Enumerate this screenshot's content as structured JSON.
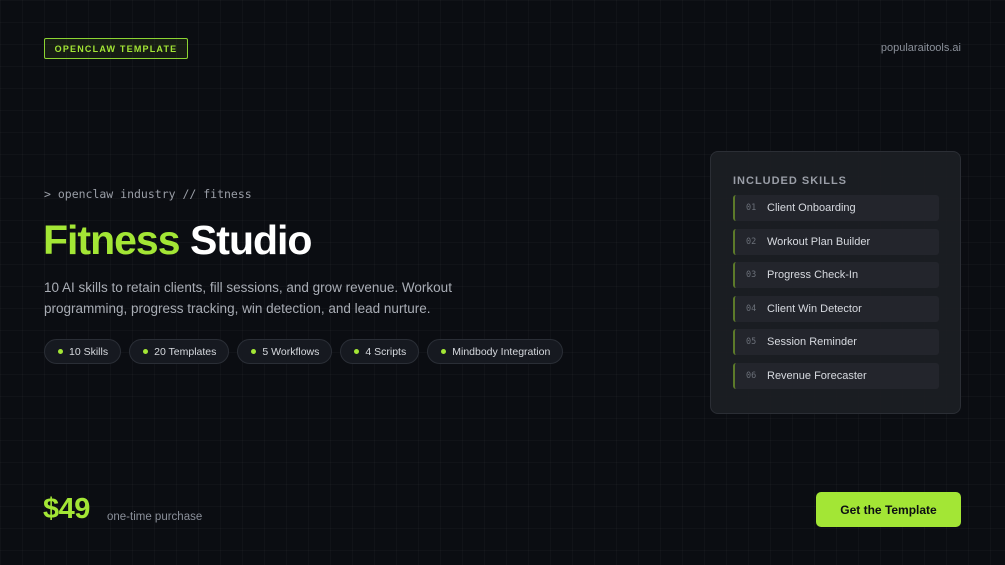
{
  "header": {
    "badge": "OPENCLAW TEMPLATE",
    "domain": "popularaitools.ai"
  },
  "hero": {
    "prompt": "> openclaw industry // fitness",
    "title_accent": "Fitness",
    "title_rest": "Studio",
    "description": "10 AI skills to retain clients, fill sessions, and grow revenue. Workout programming, progress tracking, win detection, and lead nurture.",
    "tags": [
      "10 Skills",
      "20 Templates",
      "5 Workflows",
      "4 Scripts",
      "Mindbody Integration"
    ]
  },
  "skills": {
    "title": "INCLUDED SKILLS",
    "items": [
      {
        "num": "01",
        "name": "Client Onboarding"
      },
      {
        "num": "02",
        "name": "Workout Plan Builder"
      },
      {
        "num": "03",
        "name": "Progress Check-In"
      },
      {
        "num": "04",
        "name": "Client Win Detector"
      },
      {
        "num": "05",
        "name": "Session Reminder"
      },
      {
        "num": "06",
        "name": "Revenue Forecaster"
      }
    ]
  },
  "pricing": {
    "price": "$49",
    "note": "one-time purchase",
    "cta_label": "Get the Template"
  },
  "colors": {
    "accent": "#a3e635",
    "background": "#0b0d12"
  }
}
